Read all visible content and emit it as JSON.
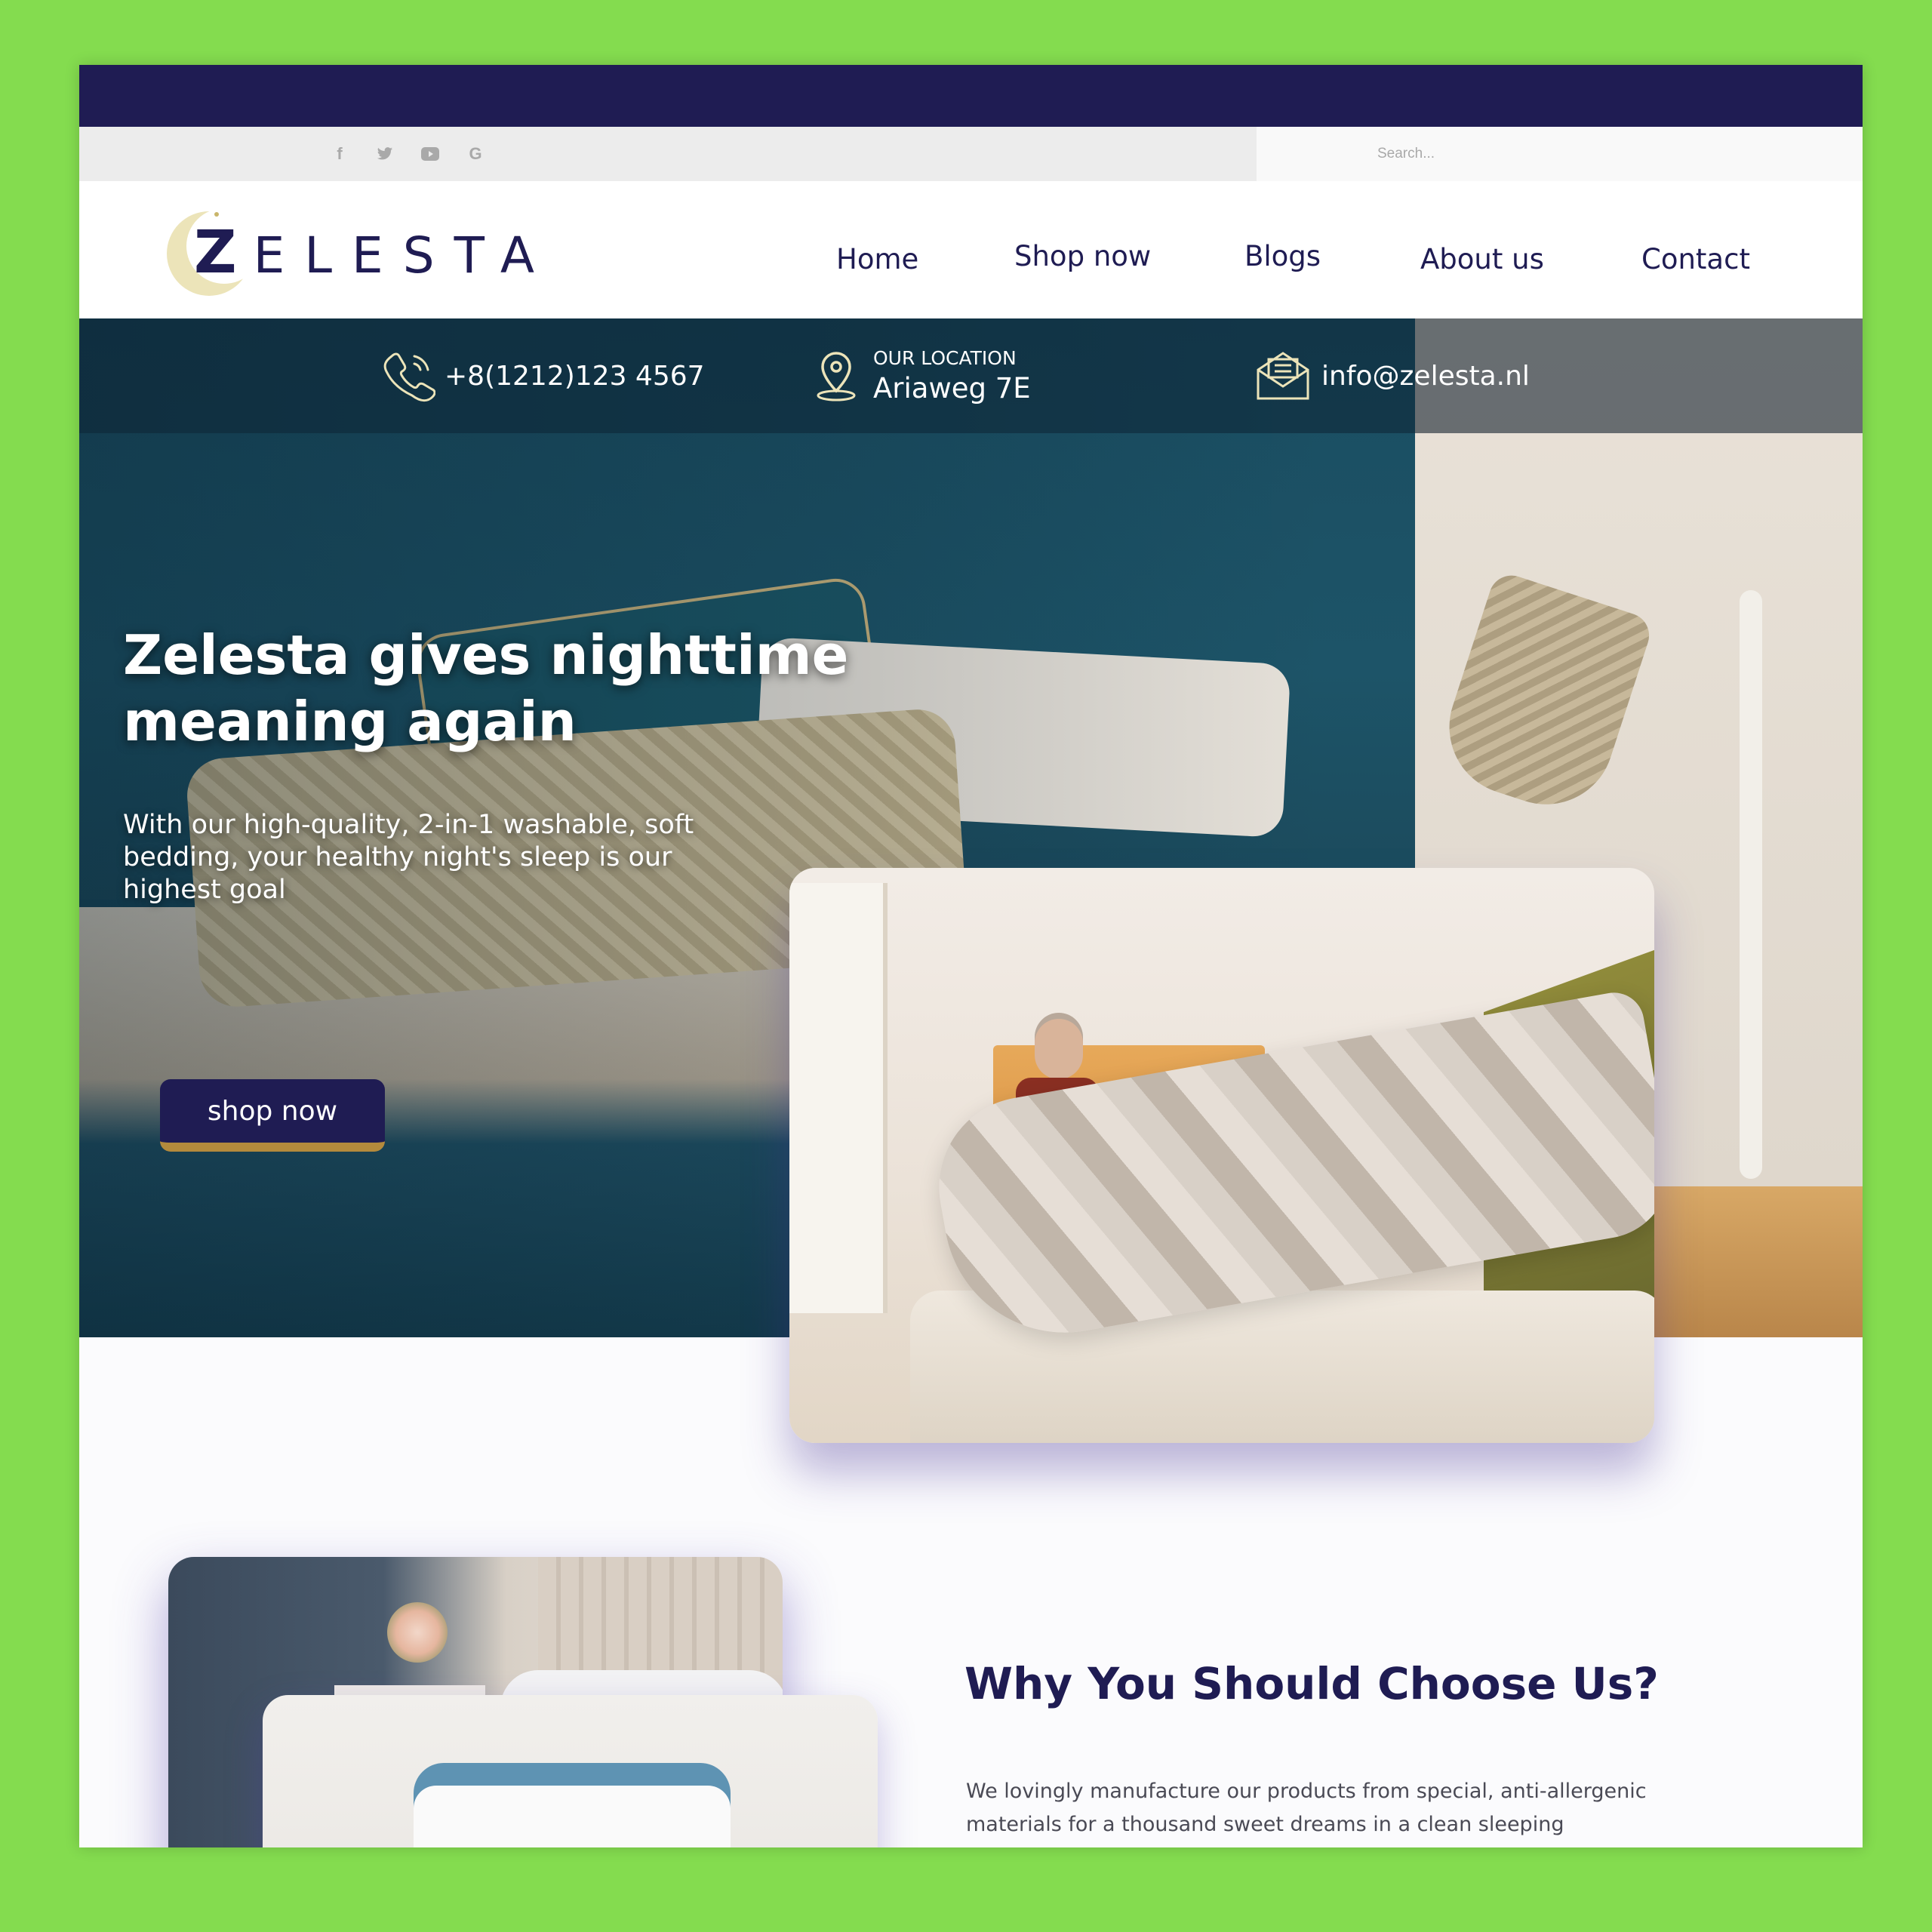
{
  "social": {
    "facebook": "f",
    "twitter": "t",
    "youtube": "▶",
    "google": "G"
  },
  "search": {
    "placeholder": "Search..."
  },
  "logo": {
    "first_letter": "Z",
    "rest": "ELESTA"
  },
  "nav": {
    "items": [
      {
        "label": "Home"
      },
      {
        "label": "Shop now"
      },
      {
        "label": "Blogs"
      },
      {
        "label": "About us"
      },
      {
        "label": "Contact"
      }
    ]
  },
  "contact": {
    "phone": "+8(1212)123 4567",
    "location_label": "OUR LOCATION",
    "location_value": "Ariaweg 7E",
    "email": "info@zelesta.nl"
  },
  "hero": {
    "title": "Zelesta gives nighttime meaning again",
    "subtitle": "With our high-quality, 2-in-1 washable, soft bedding, your healthy night's sleep is our highest goal",
    "button_label": "shop now"
  },
  "why": {
    "title": "Why You Should Choose Us?",
    "text": "We lovingly manufacture our products from special, anti-allergenic materials for a thousand sweet dreams in a clean sleeping environment. For the difficult sleepers, the satisfied sleepers, the sleepers looking for extra luxury and comfort, the toilers and the dreamers"
  },
  "colors": {
    "brand_navy": "#1f1c53",
    "accent_gold": "#b48a3c",
    "background_green": "#84dc4f"
  },
  "icons": [
    "facebook-icon",
    "twitter-icon",
    "youtube-icon",
    "google-icon",
    "search-icon",
    "phone-icon",
    "location-pin-icon",
    "email-icon",
    "moon-logo-icon"
  ]
}
